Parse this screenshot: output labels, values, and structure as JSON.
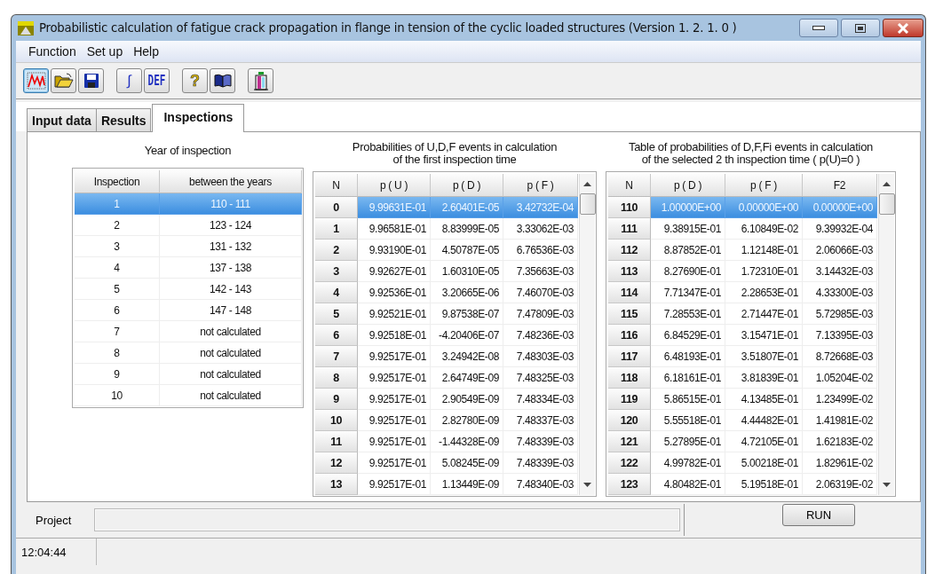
{
  "window": {
    "title": "Probabilistic calculation of fatigue crack propagation in flange in tension of the cyclic loaded structures (Version 1. 2. 1. 0 )"
  },
  "menu": [
    "Function",
    "Set up",
    "Help"
  ],
  "toolbar": [
    {
      "kind": "chart",
      "selected": true
    },
    {
      "kind": "open",
      "selected": false
    },
    {
      "kind": "save",
      "selected": false
    },
    {
      "kind": "integral",
      "label": "∫",
      "selected": false
    },
    {
      "kind": "def",
      "label": "DEF",
      "selected": false
    },
    {
      "kind": "help",
      "label": "?",
      "selected": false
    },
    {
      "kind": "book",
      "selected": false
    },
    {
      "kind": "door",
      "selected": false
    }
  ],
  "tabs": [
    {
      "label": "Input data",
      "selected": false
    },
    {
      "label": "Results",
      "selected": false
    },
    {
      "label": "Inspections",
      "selected": true
    }
  ],
  "inspections": {
    "title": [
      "Year of inspection"
    ],
    "columns": [
      "Inspection",
      "between the years"
    ],
    "rows": [
      {
        "cells": [
          "1",
          "110 - 111"
        ],
        "selected": true
      },
      {
        "cells": [
          "2",
          "123 - 124"
        ],
        "selected": false
      },
      {
        "cells": [
          "3",
          "131 - 132"
        ],
        "selected": false
      },
      {
        "cells": [
          "4",
          "137 - 138"
        ],
        "selected": false
      },
      {
        "cells": [
          "5",
          "142 - 143"
        ],
        "selected": false
      },
      {
        "cells": [
          "6",
          "147 - 148"
        ],
        "selected": false
      },
      {
        "cells": [
          "7",
          "not calculated"
        ],
        "selected": false
      },
      {
        "cells": [
          "8",
          "not calculated"
        ],
        "selected": false
      },
      {
        "cells": [
          "9",
          "not calculated"
        ],
        "selected": false
      },
      {
        "cells": [
          "10",
          "not calculated"
        ],
        "selected": false
      }
    ]
  },
  "first_inspection": {
    "title": [
      "Probabilities of U,D,F events in calculation",
      "of the first inspection time"
    ],
    "columns": [
      "N",
      "p ( U )",
      "p ( D )",
      "p ( F )"
    ],
    "rows": [
      {
        "cells": [
          "0",
          "9.99631E-01",
          "2.60401E-05",
          "3.42732E-04"
        ],
        "selected": true
      },
      {
        "cells": [
          "1",
          "9.96581E-01",
          "8.83999E-05",
          "3.33062E-03"
        ],
        "selected": false
      },
      {
        "cells": [
          "2",
          "9.93190E-01",
          "4.50787E-05",
          "6.76536E-03"
        ],
        "selected": false
      },
      {
        "cells": [
          "3",
          "9.92627E-01",
          "1.60310E-05",
          "7.35663E-03"
        ],
        "selected": false
      },
      {
        "cells": [
          "4",
          "9.92536E-01",
          "3.20665E-06",
          "7.46070E-03"
        ],
        "selected": false
      },
      {
        "cells": [
          "5",
          "9.92521E-01",
          "9.87538E-07",
          "7.47809E-03"
        ],
        "selected": false
      },
      {
        "cells": [
          "6",
          "9.92518E-01",
          "-4.20406E-07",
          "7.48236E-03"
        ],
        "selected": false
      },
      {
        "cells": [
          "7",
          "9.92517E-01",
          "3.24942E-08",
          "7.48303E-03"
        ],
        "selected": false
      },
      {
        "cells": [
          "8",
          "9.92517E-01",
          "2.64749E-09",
          "7.48325E-03"
        ],
        "selected": false
      },
      {
        "cells": [
          "9",
          "9.92517E-01",
          "2.90549E-09",
          "7.48334E-03"
        ],
        "selected": false
      },
      {
        "cells": [
          "10",
          "9.92517E-01",
          "2.82780E-09",
          "7.48337E-03"
        ],
        "selected": false
      },
      {
        "cells": [
          "11",
          "9.92517E-01",
          "-1.44328E-09",
          "7.48339E-03"
        ],
        "selected": false
      },
      {
        "cells": [
          "12",
          "9.92517E-01",
          "5.08245E-09",
          "7.48339E-03"
        ],
        "selected": false
      },
      {
        "cells": [
          "13",
          "9.92517E-01",
          "1.13449E-09",
          "7.48340E-03"
        ],
        "selected": false
      }
    ]
  },
  "selected_inspection": {
    "title": [
      "Table of probabilities of D,F,Fi events in calculation",
      "of the selected  2 th  inspection time ( p(U)=0 )"
    ],
    "columns": [
      "N",
      "p ( D )",
      "p ( F )",
      "F2"
    ],
    "rows": [
      {
        "cells": [
          "110",
          "1.00000E+00",
          "0.00000E+00",
          "0.00000E+00"
        ],
        "selected": true
      },
      {
        "cells": [
          "111",
          "9.38915E-01",
          "6.10849E-02",
          "9.39932E-04"
        ],
        "selected": false
      },
      {
        "cells": [
          "112",
          "8.87852E-01",
          "1.12148E-01",
          "2.06066E-03"
        ],
        "selected": false
      },
      {
        "cells": [
          "113",
          "8.27690E-01",
          "1.72310E-01",
          "3.14432E-03"
        ],
        "selected": false
      },
      {
        "cells": [
          "114",
          "7.71347E-01",
          "2.28653E-01",
          "4.33300E-03"
        ],
        "selected": false
      },
      {
        "cells": [
          "115",
          "7.28553E-01",
          "2.71447E-01",
          "5.72985E-03"
        ],
        "selected": false
      },
      {
        "cells": [
          "116",
          "6.84529E-01",
          "3.15471E-01",
          "7.13395E-03"
        ],
        "selected": false
      },
      {
        "cells": [
          "117",
          "6.48193E-01",
          "3.51807E-01",
          "8.72668E-03"
        ],
        "selected": false
      },
      {
        "cells": [
          "118",
          "6.18161E-01",
          "3.81839E-01",
          "1.05204E-02"
        ],
        "selected": false
      },
      {
        "cells": [
          "119",
          "5.86515E-01",
          "4.13485E-01",
          "1.23499E-02"
        ],
        "selected": false
      },
      {
        "cells": [
          "120",
          "5.55518E-01",
          "4.44482E-01",
          "1.41981E-02"
        ],
        "selected": false
      },
      {
        "cells": [
          "121",
          "5.27895E-01",
          "4.72105E-01",
          "1.62183E-02"
        ],
        "selected": false
      },
      {
        "cells": [
          "122",
          "4.99782E-01",
          "5.00218E-01",
          "1.82961E-02"
        ],
        "selected": false
      },
      {
        "cells": [
          "123",
          "4.80482E-01",
          "5.19518E-01",
          "2.06319E-02"
        ],
        "selected": false
      }
    ]
  },
  "project": {
    "label": "Project",
    "run_button": "RUN"
  },
  "status_bar": {
    "time": "12:04:44"
  }
}
